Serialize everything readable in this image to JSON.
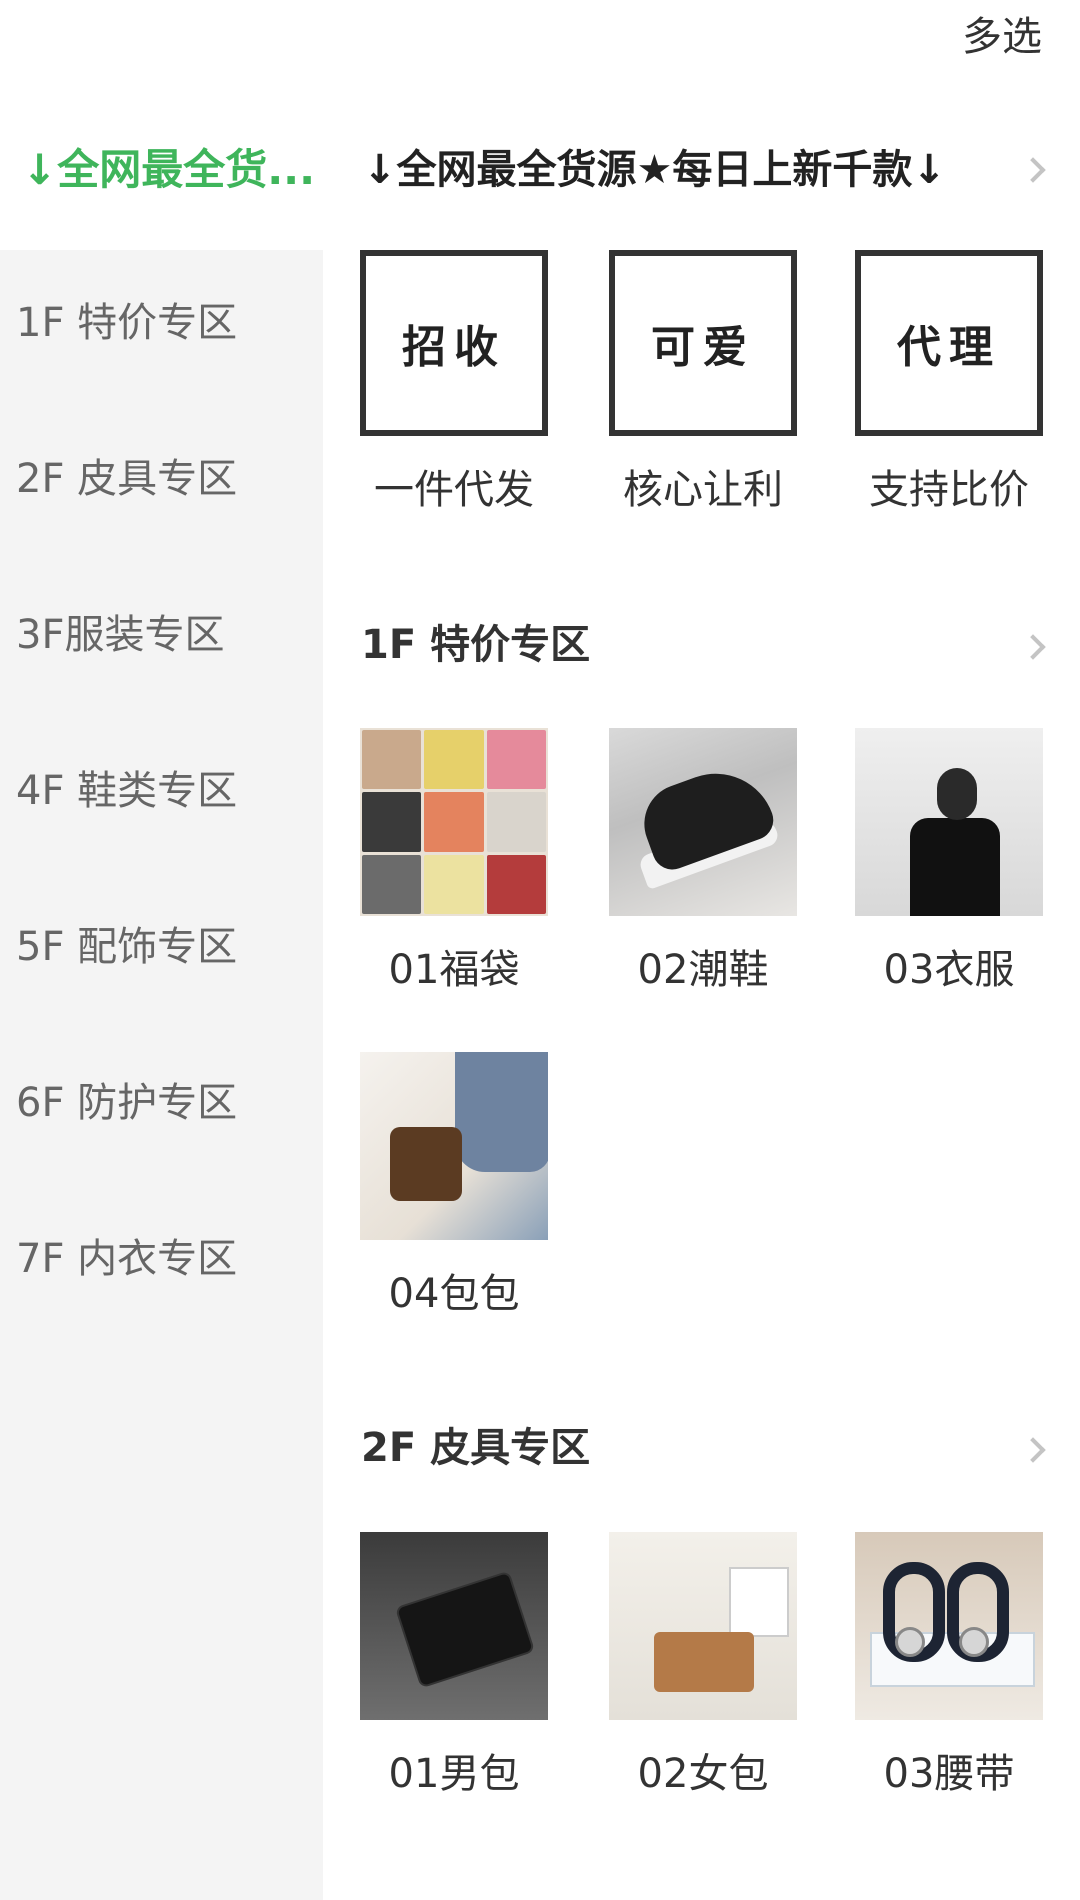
{
  "topbar": {
    "multi_select": "多选"
  },
  "sidebar": {
    "active": "↓全网最全货...",
    "items": [
      {
        "label": "1F 特价专区"
      },
      {
        "label": "2F 皮具专区"
      },
      {
        "label": "3F服装专区"
      },
      {
        "label": "4F 鞋类专区"
      },
      {
        "label": "5F 配饰专区"
      },
      {
        "label": "6F 防护专区"
      },
      {
        "label": "7F 内衣专区"
      }
    ]
  },
  "main": {
    "banner_title": "↓全网最全货源★每日上新千款↓",
    "promos": [
      {
        "card": "招收",
        "caption": "一件代发"
      },
      {
        "card": "可爱",
        "caption": "核心让利"
      },
      {
        "card": "代理",
        "caption": "支持比价"
      }
    ],
    "sections": [
      {
        "title": "1F 特价专区",
        "items": [
          {
            "label": "01福袋",
            "image": "clothing-collage"
          },
          {
            "label": "02潮鞋",
            "image": "black-sneaker"
          },
          {
            "label": "03衣服",
            "image": "black-tshirt"
          },
          {
            "label": "04包包",
            "image": "brown-bag"
          }
        ]
      },
      {
        "title": "2F 皮具专区",
        "items": [
          {
            "label": "01男包",
            "image": "black-wallet"
          },
          {
            "label": "02女包",
            "image": "tan-handbag"
          },
          {
            "label": "03腰带",
            "image": "leather-belts"
          }
        ]
      }
    ]
  },
  "colors": {
    "accent": "#3fb55b",
    "sidebar_bg": "#f4f4f4",
    "text": "#333333"
  }
}
